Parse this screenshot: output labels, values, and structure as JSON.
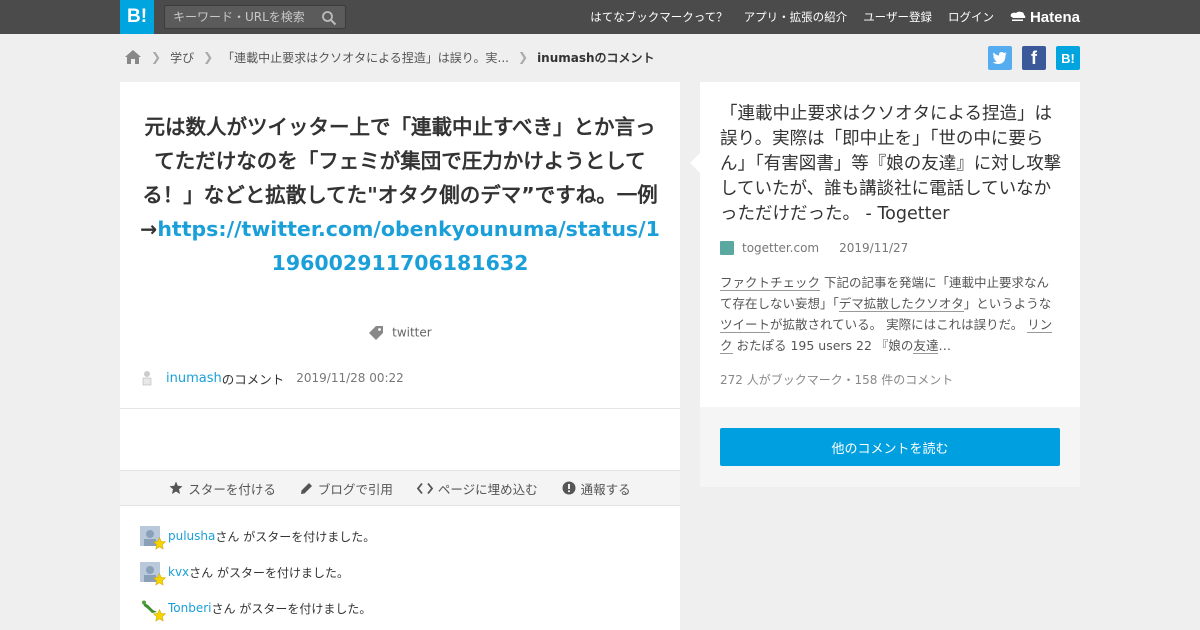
{
  "header": {
    "logo": "B!",
    "search_placeholder": "キーワード・URLを検索",
    "nav": [
      {
        "label": "はてなブックマークって？"
      },
      {
        "label": "アプリ・拡張の紹介"
      },
      {
        "label": "ユーザー登録"
      },
      {
        "label": "ログイン"
      }
    ],
    "brand": "Hatena"
  },
  "breadcrumb": {
    "items": [
      "学び",
      "「連載中止要求はクソオタによる捏造」は誤り。実..."
    ],
    "current": "inumashのコメント"
  },
  "share": {
    "facebook": "f",
    "hatebu": "B!"
  },
  "comment": {
    "text": "元は数人がツイッター上で「連載中止すべき」とか言ってただけなのを「フェミが集団で圧力かけようとしてる！」などと拡散してた\"オタク側のデマ”ですね。一例→",
    "link": "https://twitter.com/obenkyounuma/status/1196002911706181632",
    "tag": "twitter",
    "user": "inumash",
    "user_suffix": "のコメント",
    "date": "2019/11/28 00:22"
  },
  "actions": {
    "star": "スターを付ける",
    "blog": "ブログで引用",
    "embed": "ページに埋め込む",
    "report": "通報する"
  },
  "stars": [
    {
      "user": "pulusha",
      "text": "さん がスターを付けました。"
    },
    {
      "user": "kvx",
      "text": "さん がスターを付けました。"
    },
    {
      "user": "Tonberi",
      "text": "さん がスターを付けました。"
    }
  ],
  "entry": {
    "title": "「連載中止要求はクソオタによる捏造」は誤り。実際は「即中止を」「世の中に要らん」「有害図書」等『娘の友達』に対し攻撃していたが、誰も講談社に電話していなかっただけだった。 - Togetter",
    "site": "togetter.com",
    "date": "2019/11/27",
    "desc": {
      "kw1": "ファクトチェック",
      "t1": " 下記の記事を発端に「連載中止要求なんて存在しない妄想」「",
      "kw2": "デマ拡散したクソオタ",
      "t2": "」というような",
      "kw3": "ツイート",
      "t3": "が拡散されている。 実際にはこれは誤りだ。 ",
      "kw4": "リンク",
      "t4": " おたぽる 195 users 22 『娘の",
      "kw5": "友達",
      "t5": "…"
    },
    "stats": "272 人がブックマーク・158 件のコメント",
    "more_button": "他のコメントを読む"
  }
}
